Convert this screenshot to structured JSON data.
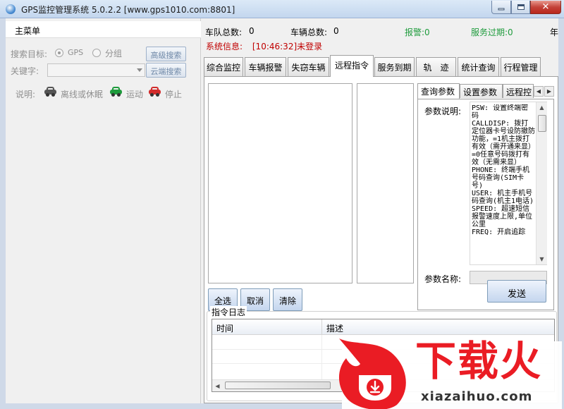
{
  "window": {
    "title": "GPS监控管理系统 5.0.2.2 [www.gps1010.com:8801]",
    "close_glyph": "✕"
  },
  "left": {
    "menu_header": "主菜单",
    "search_target_label": "搜索目标:",
    "radio_gps": "GPS",
    "radio_group": "分组",
    "selected_radio": "GPS",
    "keyword_label": "关键字:",
    "keyword_value": "",
    "advanced_search": "高级搜索",
    "cloud_search": "云端搜索",
    "legend_label": "说明:",
    "legend": [
      {
        "icon": "car-offline-icon",
        "label": "离线或休眠",
        "color": "#555555"
      },
      {
        "icon": "car-moving-icon",
        "label": "运动",
        "color": "#1e9b3c"
      },
      {
        "icon": "car-stopped-icon",
        "label": "停止",
        "color": "#d22b2b"
      }
    ]
  },
  "status": {
    "fleet_label": "车队总数:",
    "fleet_count": "0",
    "vehicle_label": "车辆总数:",
    "vehicle_count": "0",
    "alarm": "报警:0",
    "alarm_color": "#1e9b3c",
    "expired": "服务过期:0",
    "expired_color": "#1e9b3c",
    "year_label": "年",
    "sysinfo_label": "系统信息:",
    "sysinfo_time": "[10:46:32]未登录"
  },
  "tabs": [
    {
      "label": "综合监控"
    },
    {
      "label": "车辆报警"
    },
    {
      "label": "失窃车辆"
    },
    {
      "label": "远程指令",
      "active": true
    },
    {
      "label": "服务到期"
    },
    {
      "label": "轨　迹"
    },
    {
      "label": "统计查询"
    },
    {
      "label": "行程管理"
    }
  ],
  "remote": {
    "select_all": "全选",
    "cancel": "取消",
    "clear": "清除",
    "inner_tabs": [
      "查询参数",
      "设置参数",
      "远程控"
    ],
    "param_desc_label": "参数说明:",
    "param_desc": "PSW: 设置终端密码\nCALLDISP: 拨打定位器卡号设防撤防功能，=1机主拨打有效（需开通来显）=0任意号码拨打有效（无需来显）\nPHONE: 终端手机号码查询(SIM卡号)\nUSER: 机主手机号码查询(机主1电话)\nSPEED: 超速短信报警速度上限,单位公里\nFREQ: 开启追踪",
    "param_name_label": "参数名称:",
    "send": "发送",
    "log_title": "指令日志",
    "log_columns": [
      "时间",
      "描述"
    ],
    "log_rows": []
  },
  "watermark": {
    "brand": "下载火",
    "url": "xiazaihuo.com",
    "brand_color": "#ea1c24"
  }
}
